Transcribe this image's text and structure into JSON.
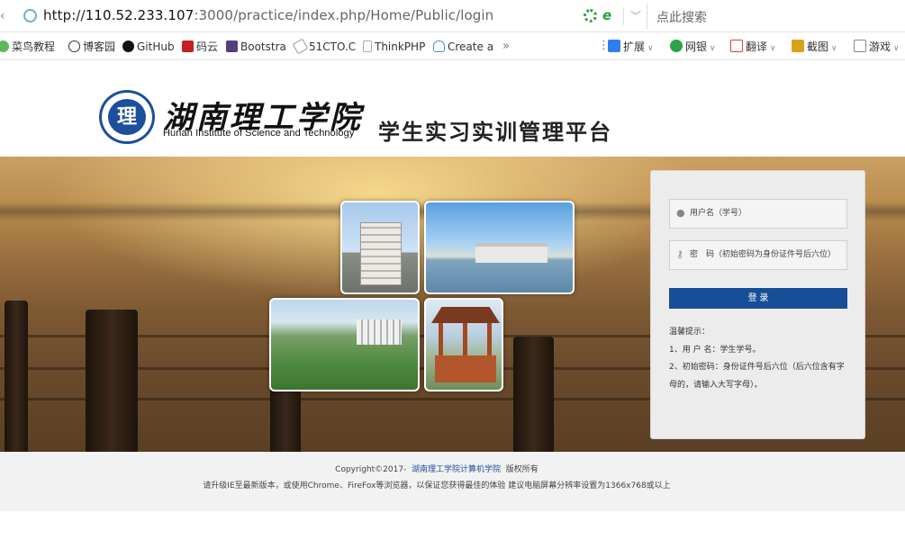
{
  "browser": {
    "url_scheme": "http://",
    "url_host": "110.52.233.107",
    "url_rest": ":3000/practice/index.php/Home/Public/login",
    "search_placeholder": "点此搜索"
  },
  "bookmarks": [
    {
      "label": "菜鸟教程",
      "icon": "runoob-icon",
      "color": "#5cb85c"
    },
    {
      "label": "博客园",
      "icon": "cnblogs-icon",
      "color": "#333333"
    },
    {
      "label": "GitHub",
      "icon": "github-icon",
      "color": "#111111"
    },
    {
      "label": "码云",
      "icon": "gitee-icon",
      "color": "#c71d23"
    },
    {
      "label": "Bootstra",
      "icon": "bootstrap-icon",
      "color": "#563d7c"
    },
    {
      "label": "51CTO.C",
      "icon": "51cto-icon",
      "color": "#888888"
    },
    {
      "label": "ThinkPHP",
      "icon": "page-icon",
      "color": "#999999"
    },
    {
      "label": "Create a",
      "icon": "cloud-icon",
      "color": "#4a90d9"
    }
  ],
  "toolbar": [
    {
      "label": "扩展",
      "icon": "extension-icon",
      "color": "#2f80ed"
    },
    {
      "label": "网银",
      "icon": "bank-icon",
      "color": "#2ca24a"
    },
    {
      "label": "翻译",
      "icon": "translate-icon",
      "color": "#e03c3c"
    },
    {
      "label": "截图",
      "icon": "screenshot-icon",
      "color": "#d9a21b"
    },
    {
      "label": "游戏",
      "icon": "game-icon",
      "color": "#7a7a7a"
    }
  ],
  "header": {
    "seal_char": "理",
    "school_cn": "湖南理工学院",
    "school_en": "Hunan Institute of Science and Technology",
    "platform_title": "学生实习实训管理平台"
  },
  "login": {
    "username_placeholder": "用户名（学号）",
    "password_placeholder": "密　码（初始密码为身份证件号后六位）",
    "submit_label": "登 录",
    "tips_title": "温馨提示：",
    "tip1": "1、用 户 名：学生学号。",
    "tip2": "2、初始密码：身份证件号后六位（后六位含有字母的，请输入大写字母）。"
  },
  "footer": {
    "copyright": "Copyright©2017-",
    "org_link": "湖南理工学院计算机学院",
    "rights": "版权所有",
    "notice": "请升级IE至最新版本，或使用Chrome、FireFox等浏览器，以保证您获得最佳的体验 建议电脑屏幕分辨率设置为1366x768或以上"
  },
  "colors": {
    "brand_blue": "#164e97",
    "link_blue": "#1c4f9c"
  }
}
